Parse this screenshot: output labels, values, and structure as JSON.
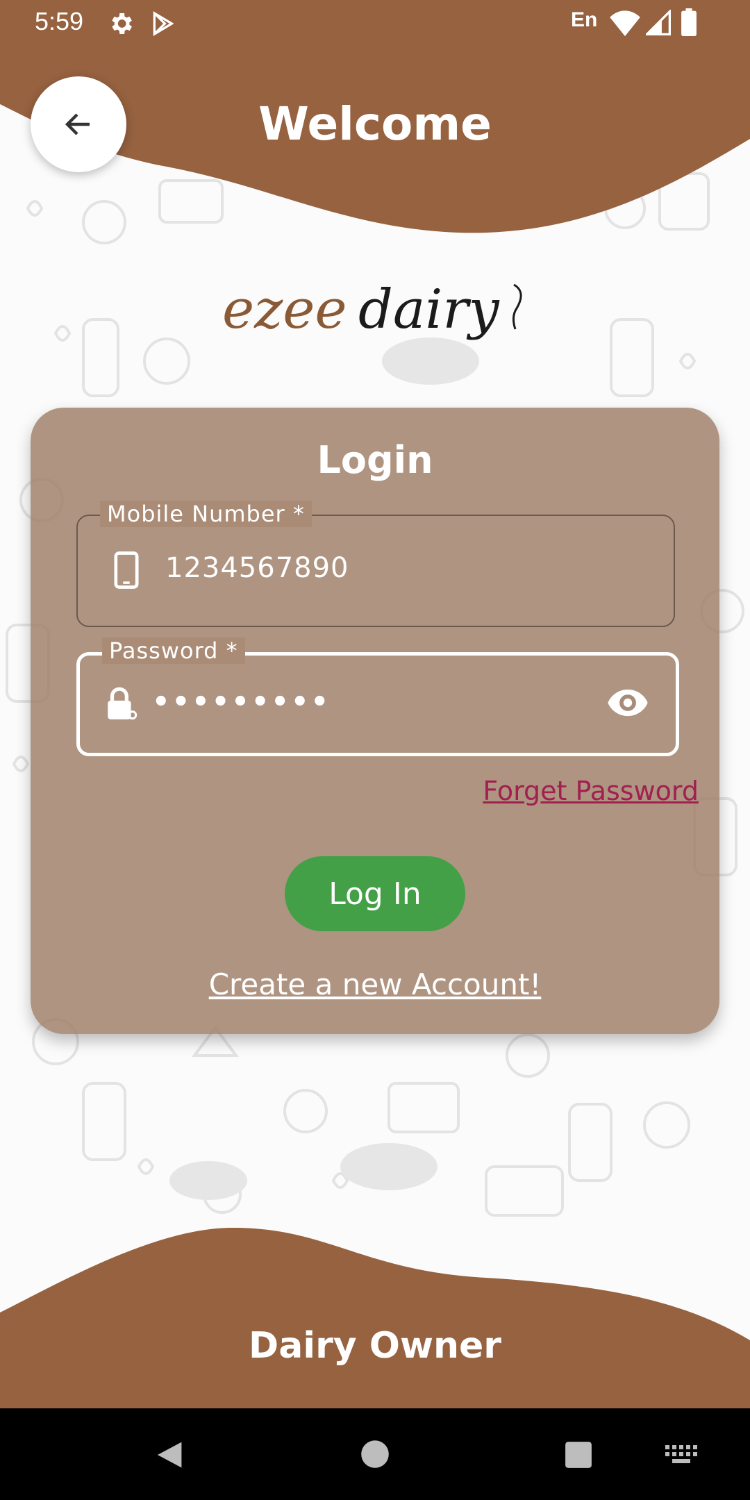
{
  "status_bar": {
    "time": "5:59",
    "language": "En",
    "icons": [
      "gear-icon",
      "play-store-icon",
      "wifi-icon",
      "signal-icon",
      "battery-icon"
    ]
  },
  "header": {
    "title": "Welcome",
    "back_icon": "arrow-left-icon"
  },
  "logo": {
    "text_part1": "ezee",
    "text_part2": "dairy"
  },
  "login_card": {
    "title": "Login",
    "mobile": {
      "label": "Mobile Number *",
      "value": "1234567890",
      "icon": "phone-icon"
    },
    "password": {
      "label": "Password *",
      "value": "•••••••••",
      "icon": "lock-icon",
      "toggle_icon": "eye-icon"
    },
    "forgot_label": "Forget Password",
    "login_button": "Log In",
    "create_account_label": "Create a new Account!"
  },
  "footer": {
    "role": "Dairy Owner"
  },
  "nav_bar": {
    "icons": [
      "back-triangle-icon",
      "home-circle-icon",
      "recents-square-icon",
      "keyboard-icon"
    ]
  },
  "colors": {
    "brand_brown": "#966240",
    "card": "#a08069",
    "login_green": "#43a047",
    "forgot_link": "#a0204f"
  }
}
